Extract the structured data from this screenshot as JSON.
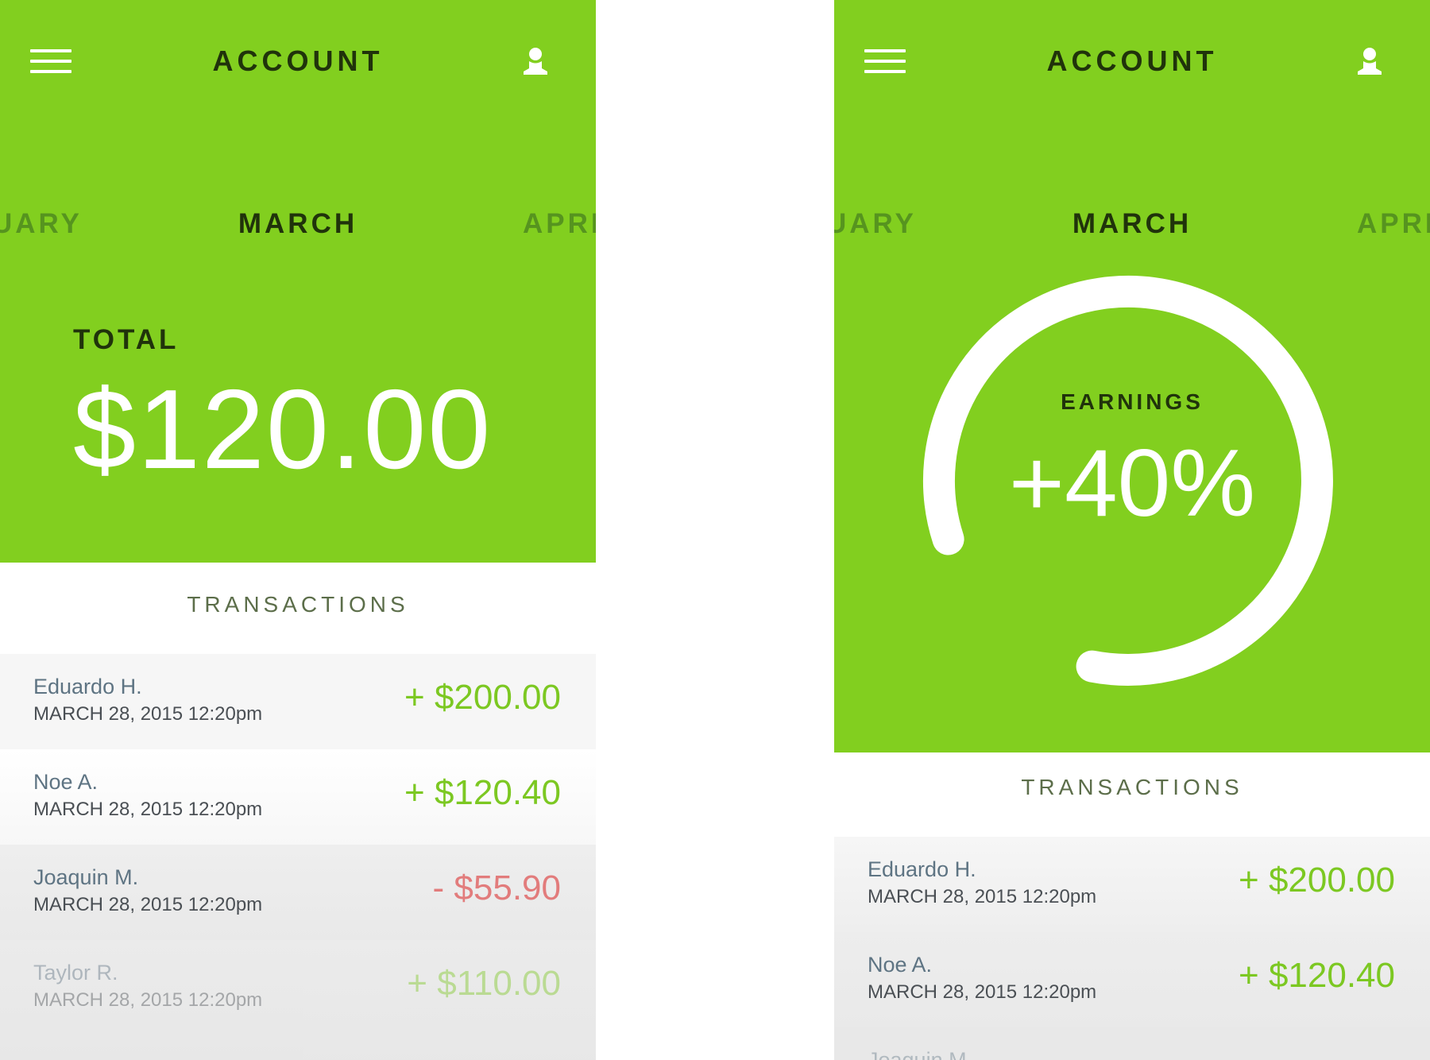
{
  "colors": {
    "accent": "#82cf1f",
    "title_dark": "#20330b",
    "positive": "#7cc822",
    "negative": "#e27c7c",
    "name_text": "#5e7483",
    "date_text": "#4a4f54"
  },
  "screens": [
    {
      "id": "left",
      "header": {
        "title": "ACCOUNT",
        "menu_icon": "hamburger-menu-icon",
        "profile_icon": "user-profile-icon"
      },
      "months": {
        "previous": "UARY",
        "current": "MARCH",
        "next": "APRI"
      },
      "summary": {
        "label": "TOTAL",
        "amount": "$120.00"
      },
      "transactions": {
        "title": "TRANSACTIONS",
        "items": [
          {
            "name": "Eduardo H.",
            "date": "MARCH 28, 2015 12:20pm",
            "amount": "+ $200.00",
            "type": "positive"
          },
          {
            "name": "Noe A.",
            "date": "MARCH 28, 2015 12:20pm",
            "amount": "+ $120.40",
            "type": "positive"
          },
          {
            "name": "Joaquin M.",
            "date": "MARCH 28, 2015 12:20pm",
            "amount": "- $55.90",
            "type": "negative"
          },
          {
            "name": "Taylor R.",
            "date": "MARCH 28, 2015 12:20pm",
            "amount": "+ $110.00",
            "type": "positive"
          }
        ]
      }
    },
    {
      "id": "right",
      "header": {
        "title": "ACCOUNT",
        "menu_icon": "hamburger-menu-icon",
        "profile_icon": "user-profile-icon"
      },
      "months": {
        "previous": "UARY",
        "current": "MARCH",
        "next": "APRI"
      },
      "earnings": {
        "label": "EARNINGS",
        "value": "+40%",
        "gauge_fraction": 0.4
      },
      "transactions": {
        "title": "TRANSACTIONS",
        "items": [
          {
            "name": "Eduardo H.",
            "date": "MARCH 28, 2015 12:20pm",
            "amount": "+ $200.00",
            "type": "positive"
          },
          {
            "name": "Noe A.",
            "date": "MARCH 28, 2015 12:20pm",
            "amount": "+ $120.40",
            "type": "positive"
          },
          {
            "name": "Joaquin M.",
            "date": "",
            "amount": "",
            "type": "negative"
          }
        ]
      }
    }
  ]
}
